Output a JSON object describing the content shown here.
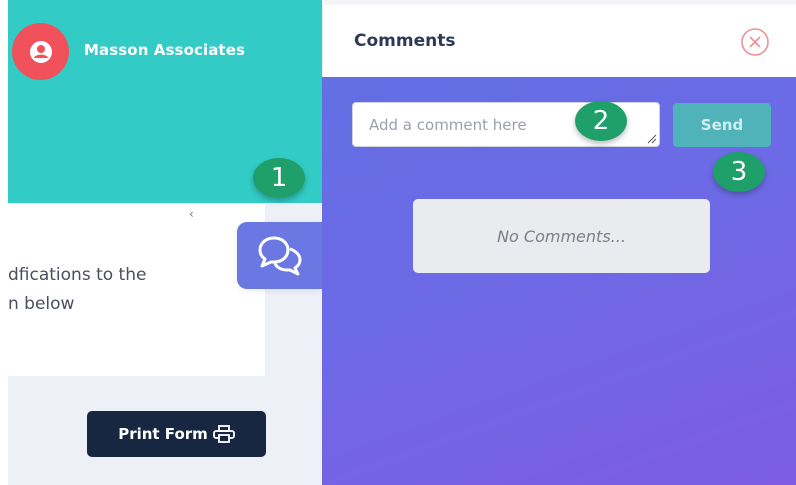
{
  "company": {
    "name": "Masson Associates"
  },
  "card": {
    "lines": [
      "dfications to the",
      "n below"
    ],
    "glyph": "‹"
  },
  "actions": {
    "print_label": "Print Form"
  },
  "comments_panel": {
    "title": "Comments",
    "input_placeholder": "Add a comment here",
    "input_value": "",
    "send_label": "Send",
    "empty_message": "No Comments..."
  },
  "annotations": [
    "1",
    "2",
    "3"
  ],
  "colors": {
    "teal_header": "#33cbc5",
    "avatar": "#f1515a",
    "chat_button": "#6b77e2",
    "print_button": "#172641",
    "send_button": "#4fb3b9",
    "badge": "#1f9f6a"
  }
}
